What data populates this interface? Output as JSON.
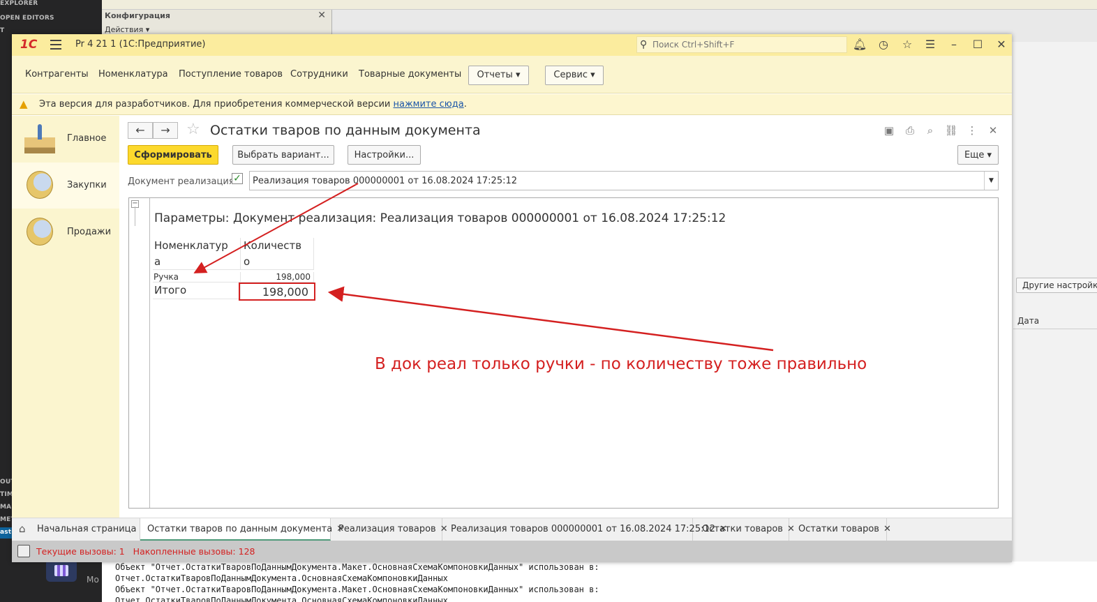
{
  "background": {
    "left_labels": [
      "EXPLORER",
      "OPEN EDITORS",
      "T",
      "OUTL",
      "TIME",
      "MAK",
      "META",
      "aste"
    ],
    "config_title": "Конфигурация",
    "config_actions": "Действия ▾",
    "right_panel_button": "Другие настройки",
    "right_panel_column": "Дата",
    "console_lines": [
      "Объект \"Отчет.ОстаткиТваровПоДаннымДокумента.Макет.ОсновнаяСхемаКомпоновкиДанных\" использован в:",
      "Отчет.ОстаткиТваровПоДаннымДокумента.ОсновнаяСхемаКомпоновкиДанных",
      "Объект \"Отчет.ОстаткиТваровПоДаннымДокумента.Макет.ОсновнаяСхемаКомпоновкиДанных\" использован в:",
      "Отчет.ОстаткиТваровПоДаннымДокумента.ОсновнаяСхемаКомпоновкиДанных"
    ],
    "taskbar_text": "Mo"
  },
  "titlebar": {
    "logo": "1С",
    "title": "Pr 4 21 1  (1С:Предприятие)",
    "search_placeholder": "Поиск Ctrl+Shift+F",
    "icons": [
      "bell-icon",
      "history-icon",
      "star-icon",
      "menu-lines-icon",
      "minimize-icon",
      "maximize-icon",
      "close-icon"
    ]
  },
  "sections": {
    "links": [
      "Контрагенты",
      "Номенклатура",
      "Поступление товаров",
      "Сотрудники",
      "Товарные документы"
    ],
    "reports_label": "Отчеты ▾",
    "service_label": "Сервис ▾"
  },
  "warning": {
    "text": "Эта версия для разработчиков. Для приобретения коммерческой версии ",
    "link": "нажмите сюда",
    "tail": "."
  },
  "sidebar": {
    "items": [
      {
        "label": "Главное",
        "icon": "desk-icon"
      },
      {
        "label": "Закупки",
        "icon": "coins-icon"
      },
      {
        "label": "Продажи",
        "icon": "coins-icon"
      }
    ]
  },
  "form": {
    "title": "Остатки тваров по данным документа",
    "generate_label": "Сформировать",
    "variant_label": "Выбрать вариант...",
    "settings_label": "Настройки...",
    "more_label": "Еще ▾",
    "doc_label": "Документ реализация:",
    "doc_checked": "✓",
    "doc_value": "Реализация товаров 000000001 от 16.08.2024 17:25:12",
    "header_icons": [
      "save-icon",
      "print-icon",
      "preview-icon",
      "link-icon",
      "more-vertical-icon",
      "close-icon"
    ]
  },
  "report": {
    "params_text": "Параметры:  Документ реализация: Реализация товаров 000000001 от 16.08.2024 17:25:12",
    "col1_line1": "Номенклатур",
    "col1_line2": "а",
    "col2_line1": "Количеств",
    "col2_line2": "о",
    "row_name": "Ручка",
    "row_qty": "198,000",
    "total_label": "Итого",
    "total_qty": "198,000"
  },
  "tabs": [
    {
      "label": "Начальная страница",
      "closable": false
    },
    {
      "label": "Остатки тваров по данным документа",
      "closable": true
    },
    {
      "label": "Реализация товаров",
      "closable": true
    },
    {
      "label": "Реализация товаров 000000001 от 16.08.2024 17:25:12",
      "closable": true
    },
    {
      "label": "Остатки товаров",
      "closable": true
    },
    {
      "label": "Остатки товаров",
      "closable": true
    }
  ],
  "status": {
    "current_calls": "Текущие вызовы: 1",
    "accumulated_calls": "Накопленные вызовы: 128"
  },
  "annotation": {
    "text": "В док реал только ручки - по количеству тоже правильно",
    "color": "#d42020"
  }
}
